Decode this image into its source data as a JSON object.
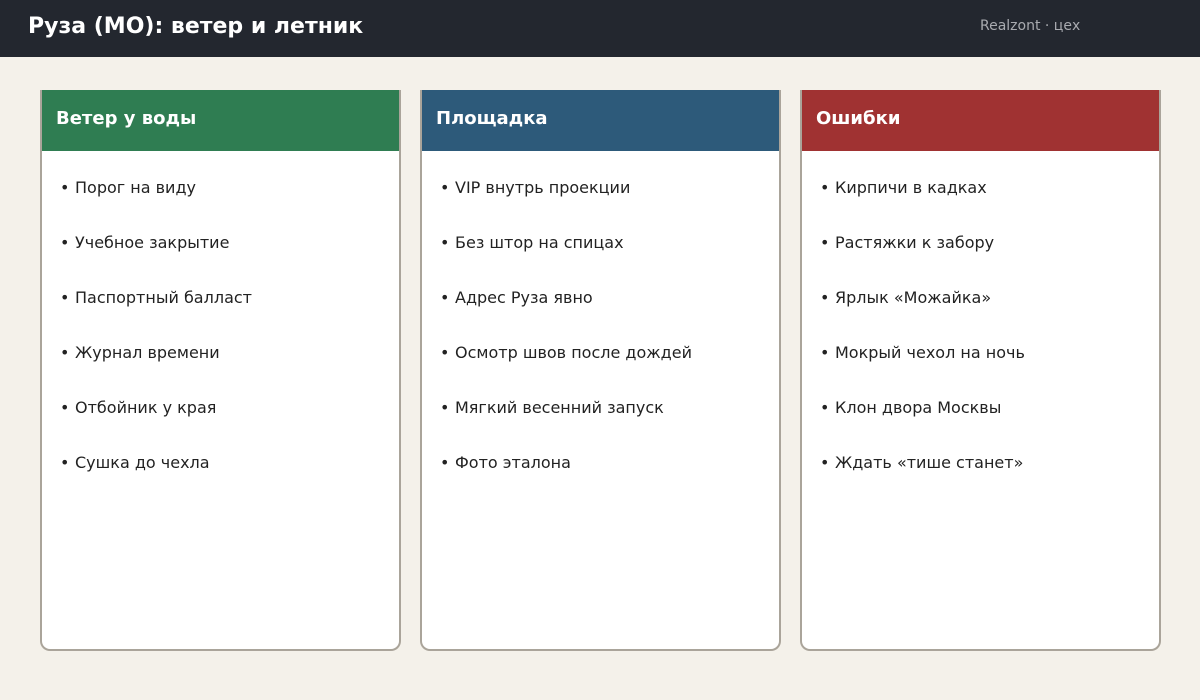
{
  "header": {
    "title": "Руза (МО): ветер и летник",
    "brand": "Realzont · цех"
  },
  "columns": [
    {
      "title": "Ветер у воды",
      "color": "#2f7d52",
      "items": [
        "Порог на виду",
        "Учебное закрытие",
        "Паспортный балласт",
        "Журнал времени",
        "Отбойник у края",
        "Сушка до чехла"
      ]
    },
    {
      "title": "Площадка",
      "color": "#2d5a7a",
      "items": [
        "VIP внутрь проекции",
        "Без штор на спицах",
        "Адрес Руза явно",
        "Осмотр швов после дождей",
        "Мягкий весенний запуск",
        "Фото эталона"
      ]
    },
    {
      "title": "Ошибки",
      "color": "#a03232",
      "items": [
        "Кирпичи в кадках",
        "Растяжки к забору",
        "Ярлык «Можайка»",
        "Мокрый чехол на ночь",
        "Клон двора Москвы",
        "Ждать «тише станет»"
      ]
    }
  ]
}
